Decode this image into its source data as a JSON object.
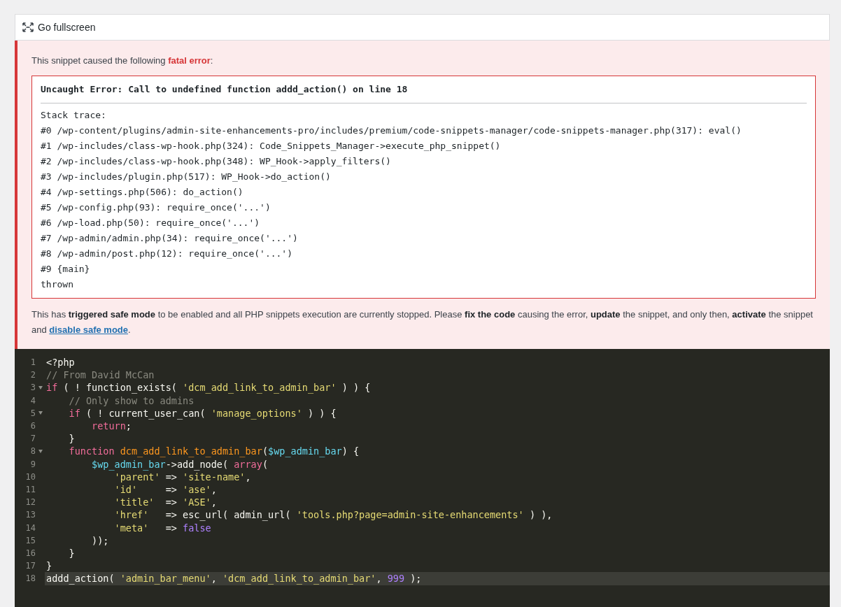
{
  "toolbar": {
    "fullscreen_label": "Go fullscreen"
  },
  "notice": {
    "intro": "This snippet caused the following **fatal error**:",
    "error": {
      "title": "Uncaught Error: Call to undefined function addd_action() on line 18",
      "trace_heading": "Stack trace:",
      "trace": [
        "#0 /wp-content/plugins/admin-site-enhancements-pro/includes/premium/code-snippets-manager/code-snippets-manager.php(317): eval()",
        "#1 /wp-includes/class-wp-hook.php(324): Code_Snippets_Manager->execute_php_snippet()",
        "#2 /wp-includes/class-wp-hook.php(348): WP_Hook->apply_filters()",
        "#3 /wp-includes/plugin.php(517): WP_Hook->do_action()",
        "#4 /wp-settings.php(506): do_action()",
        "#5 /wp-config.php(93): require_once('...')",
        "#6 /wp-load.php(50): require_once('...')",
        "#7 /wp-admin/admin.php(34): require_once('...')",
        "#8 /wp-admin/post.php(12): require_once('...')",
        "#9 {main}"
      ],
      "trailer": "thrown"
    },
    "message": "This has **triggered safe mode** to be enabled and all PHP snippets execution are currently stopped. Please **fix the code** causing the error, **update** the snippet, and only then, **activate** the snippet and ",
    "link": "disable safe mode",
    "message_end": "."
  },
  "code": {
    "lines": [
      {
        "number": "1",
        "fold": false,
        "active": false,
        "tokens": [
          {
            "kind": "plain",
            "text": "<?php"
          }
        ]
      },
      {
        "number": "2",
        "fold": false,
        "active": false,
        "tokens": [
          {
            "kind": "comment",
            "text": "// From David McCan"
          }
        ]
      },
      {
        "number": "3",
        "fold": true,
        "active": false,
        "tokens": [
          {
            "kind": "keyword",
            "text": "if"
          },
          {
            "kind": "plain",
            "text": " ( ! function_exists( "
          },
          {
            "kind": "string",
            "text": "'dcm_add_link_to_admin_bar'"
          },
          {
            "kind": "plain",
            "text": " ) ) {"
          }
        ]
      },
      {
        "number": "4",
        "fold": false,
        "active": false,
        "tokens": [
          {
            "kind": "comment",
            "text": "    // Only show to admins"
          }
        ]
      },
      {
        "number": "5",
        "fold": true,
        "active": false,
        "tokens": [
          {
            "kind": "keyword",
            "text": "    if"
          },
          {
            "kind": "plain",
            "text": " ( ! current_user_can( "
          },
          {
            "kind": "string",
            "text": "'manage_options'"
          },
          {
            "kind": "plain",
            "text": " ) ) {"
          }
        ]
      },
      {
        "number": "6",
        "fold": false,
        "active": false,
        "tokens": [
          {
            "kind": "keyword",
            "text": "        return"
          },
          {
            "kind": "plain",
            "text": ";"
          }
        ]
      },
      {
        "number": "7",
        "fold": false,
        "active": false,
        "tokens": [
          {
            "kind": "plain",
            "text": "    }"
          }
        ]
      },
      {
        "number": "8",
        "fold": true,
        "active": false,
        "tokens": [
          {
            "kind": "keyword",
            "text": "    function"
          },
          {
            "kind": "function",
            "text": " dcm_add_link_to_admin_bar"
          },
          {
            "kind": "plain",
            "text": "("
          },
          {
            "kind": "variable",
            "text": "$wp_admin_bar"
          },
          {
            "kind": "plain",
            "text": ") {"
          }
        ]
      },
      {
        "number": "9",
        "fold": false,
        "active": false,
        "tokens": [
          {
            "kind": "variable",
            "text": "        $wp_admin_bar"
          },
          {
            "kind": "plain",
            "text": "->add_node( "
          },
          {
            "kind": "keyword",
            "text": "array"
          },
          {
            "kind": "plain",
            "text": "("
          }
        ]
      },
      {
        "number": "10",
        "fold": false,
        "active": false,
        "tokens": [
          {
            "kind": "string",
            "text": "            'parent'"
          },
          {
            "kind": "plain",
            "text": " => "
          },
          {
            "kind": "string",
            "text": "'site-name'"
          },
          {
            "kind": "plain",
            "text": ","
          }
        ]
      },
      {
        "number": "11",
        "fold": false,
        "active": false,
        "tokens": [
          {
            "kind": "string",
            "text": "            'id'"
          },
          {
            "kind": "plain",
            "text": "     => "
          },
          {
            "kind": "string",
            "text": "'ase'"
          },
          {
            "kind": "plain",
            "text": ","
          }
        ]
      },
      {
        "number": "12",
        "fold": false,
        "active": false,
        "tokens": [
          {
            "kind": "string",
            "text": "            'title'"
          },
          {
            "kind": "plain",
            "text": "  => "
          },
          {
            "kind": "string",
            "text": "'ASE'"
          },
          {
            "kind": "plain",
            "text": ","
          }
        ]
      },
      {
        "number": "13",
        "fold": false,
        "active": false,
        "tokens": [
          {
            "kind": "string",
            "text": "            'href'"
          },
          {
            "kind": "plain",
            "text": "   => esc_url( admin_url( "
          },
          {
            "kind": "string",
            "text": "'tools.php?page=admin-site-enhancements'"
          },
          {
            "kind": "plain",
            "text": " ) ),"
          }
        ]
      },
      {
        "number": "14",
        "fold": false,
        "active": false,
        "tokens": [
          {
            "kind": "string",
            "text": "            'meta'"
          },
          {
            "kind": "plain",
            "text": "   => "
          },
          {
            "kind": "constant",
            "text": "false"
          }
        ]
      },
      {
        "number": "15",
        "fold": false,
        "active": false,
        "tokens": [
          {
            "kind": "plain",
            "text": "        ));"
          }
        ]
      },
      {
        "number": "16",
        "fold": false,
        "active": false,
        "tokens": [
          {
            "kind": "plain",
            "text": "    }"
          }
        ]
      },
      {
        "number": "17",
        "fold": false,
        "active": false,
        "tokens": [
          {
            "kind": "plain",
            "text": "}"
          }
        ]
      },
      {
        "number": "18",
        "fold": false,
        "active": true,
        "tokens": [
          {
            "kind": "plain",
            "text": "addd_action( "
          },
          {
            "kind": "string",
            "text": "'admin_bar_menu'"
          },
          {
            "kind": "plain",
            "text": ", "
          },
          {
            "kind": "string",
            "text": "'dcm_add_link_to_admin_bar'"
          },
          {
            "kind": "plain",
            "text": ", "
          },
          {
            "kind": "constant",
            "text": "999"
          },
          {
            "kind": "plain",
            "text": " );"
          }
        ]
      }
    ]
  }
}
